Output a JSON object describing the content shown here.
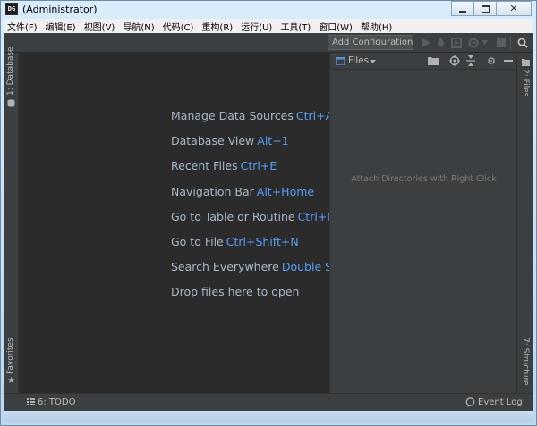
{
  "window": {
    "title": "(Administrator)",
    "app_icon_text": "DG"
  },
  "menu": [
    "文件(F)",
    "编辑(E)",
    "视图(V)",
    "导航(N)",
    "代码(C)",
    "重构(R)",
    "运行(U)",
    "工具(T)",
    "窗口(W)",
    "帮助(H)"
  ],
  "toolbar": {
    "config_label": "Add Configuration...",
    "icons": [
      "run-icon",
      "debug-icon",
      "coverage-icon",
      "profile-icon",
      "dropdown-icon",
      "stop-icon",
      "search-icon"
    ]
  },
  "left_strip": {
    "database_tab": "1: Database",
    "favorites_tab": "Favorites"
  },
  "right_strip": {
    "files_tab": "2: Files",
    "structure_tab": "7: Structure"
  },
  "welcome": {
    "hints": [
      {
        "text": "Manage Data Sources",
        "key": "Ctrl+Alt+"
      },
      {
        "text": "Database View",
        "key": "Alt+1"
      },
      {
        "text": "Recent Files",
        "key": "Ctrl+E"
      },
      {
        "text": "Navigation Bar",
        "key": "Alt+Home"
      },
      {
        "text": "Go to Table or Routine",
        "key": "Ctrl+N"
      },
      {
        "text": "Go to File",
        "key": "Ctrl+Shift+N"
      },
      {
        "text": "Search Everywhere",
        "key": "Double Shif"
      },
      {
        "text": "Drop files here to open",
        "key": ""
      }
    ]
  },
  "files_panel": {
    "title": "Files",
    "empty_text": "Attach Directories with Right Click"
  },
  "statusbar": {
    "todo": "6: TODO",
    "event_log": "Event Log"
  },
  "colors": {
    "ide_bg": "#2b2b2b",
    "panel_bg": "#3c3f41",
    "text": "#bbbbbb",
    "shortcut": "#589df6"
  }
}
